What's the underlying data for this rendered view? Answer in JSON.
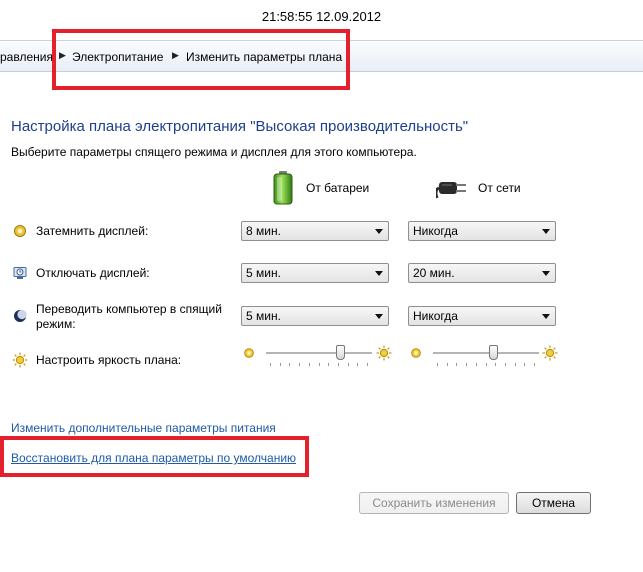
{
  "timestamp": "21:58:55 12.09.2012",
  "breadcrumb": [
    "равления",
    "Электропитание",
    "Изменить параметры плана"
  ],
  "title": "Настройка плана электропитания \"Высокая производительность\"",
  "subtitle": "Выберите параметры спящего режима и дисплея для этого компьютера.",
  "columns": {
    "battery": "От батареи",
    "plugged": "От сети"
  },
  "rows": [
    {
      "label": "Затемнить дисплей:",
      "battery": "8 мин.",
      "plugged": "Никогда"
    },
    {
      "label": "Отключать дисплей:",
      "battery": "5 мин.",
      "plugged": "20 мин."
    },
    {
      "label_line1": "Переводить компьютер в спящий",
      "label_line2": "режим:",
      "battery": "5 мин.",
      "plugged": "Никогда"
    }
  ],
  "brightness": {
    "label": "Настроить яркость плана:",
    "battery_level": 0.72,
    "plugged_level": 0.58
  },
  "links": {
    "advanced": "Изменить дополнительные параметры питания",
    "restore": "Восстановить для плана параметры по умолчанию"
  },
  "buttons": {
    "save": "Сохранить изменения",
    "cancel": "Отмена"
  },
  "colors": {
    "annotation": "#e3202c",
    "title": "#1e3f8c",
    "link": "#1e5aa8"
  }
}
